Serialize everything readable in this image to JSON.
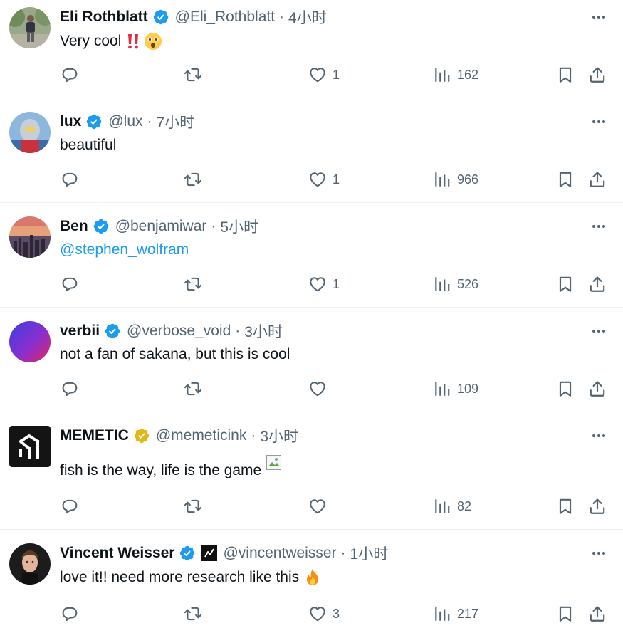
{
  "colors": {
    "text": "#0f1419",
    "secondary": "#536471",
    "accent": "#1d9bf0",
    "gold_badge": "#e2b719",
    "divider": "#eff3f4"
  },
  "tweets": [
    {
      "name": "Eli Rothblatt",
      "badge": "verified-blue-icon",
      "handle": "@Eli_Rothblatt",
      "dot": "·",
      "time": "4小时",
      "text": "Very cool",
      "emoji": [
        "double-exclamation-icon",
        "astonished-face-icon"
      ],
      "likes": "1",
      "views": "162"
    },
    {
      "name": "lux",
      "badge": "verified-blue-icon",
      "handle": "@lux",
      "dot": "·",
      "time": "7小时",
      "text": "beautiful",
      "likes": "1",
      "views": "966"
    },
    {
      "name": "Ben",
      "badge": "verified-blue-icon",
      "handle": "@benjamiwar",
      "dot": "·",
      "time": "5小时",
      "text": "@stephen_wolfram",
      "likes": "1",
      "views": "526"
    },
    {
      "name": "verbii",
      "badge": "verified-blue-icon",
      "handle": "@verbose_void",
      "dot": "·",
      "time": "3小时",
      "text": "not a fan of sakana, but this is cool",
      "likes": "",
      "views": "109"
    },
    {
      "name": "MEMETIC",
      "badge": "verified-gold-icon",
      "handle": "@memeticink",
      "dot": "·",
      "time": "3小时",
      "text": "fish is the way, life is the game",
      "image": "broken-image-icon",
      "likes": "",
      "views": "82"
    },
    {
      "name": "Vincent Weisser",
      "badge": "verified-blue-icon",
      "affiliate": "affiliate-logo-icon",
      "handle": "@vincentweisser",
      "dot": "·",
      "time": "1小时",
      "text": "love it!! need more research like this",
      "emoji": [
        "fire-icon"
      ],
      "likes": "3",
      "views": "217"
    }
  ]
}
